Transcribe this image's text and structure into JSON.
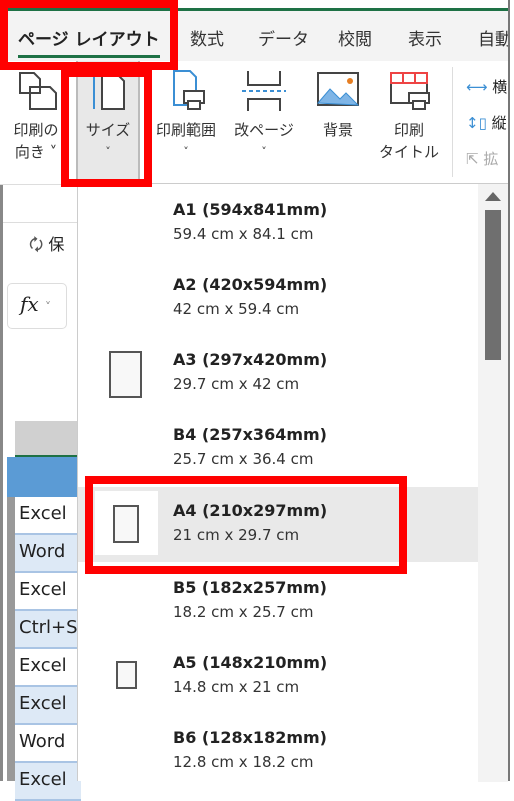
{
  "tabs": [
    {
      "label": "ページ レイアウト",
      "active": true
    },
    {
      "label": "数式"
    },
    {
      "label": "データ"
    },
    {
      "label": "校閲"
    },
    {
      "label": "表示"
    },
    {
      "label": "自動"
    }
  ],
  "ribbon": {
    "orientation": {
      "line1": "印刷の",
      "line2": "向き ˅"
    },
    "size": {
      "label": "サイズ",
      "chevron": "˅"
    },
    "print_area": {
      "label": "印刷範囲",
      "chevron": "˅"
    },
    "breaks": {
      "label": "改ページ",
      "chevron": "˅"
    },
    "background": {
      "label": "背景"
    },
    "print_titles": {
      "line1": "印刷",
      "line2": "タイトル"
    },
    "right": {
      "width": "横",
      "height": "縦",
      "scale": "拡"
    }
  },
  "sheet": {
    "save_label": "保",
    "fx": "fx",
    "rows": [
      "Excel",
      "Word",
      "Excel",
      "Ctrl+S",
      "Excel",
      "Excel",
      "Word",
      "Excel"
    ]
  },
  "size_menu": {
    "selected": "A4",
    "items": [
      {
        "name": "A1 (594x841mm)",
        "dims": "59.4 cm x 84.1 cm"
      },
      {
        "name": "A2 (420x594mm)",
        "dims": "42 cm x 59.4 cm"
      },
      {
        "name": "A3 (297x420mm)",
        "dims": "29.7 cm x 42 cm"
      },
      {
        "name": "B4 (257x364mm)",
        "dims": "25.7 cm x 36.4 cm"
      },
      {
        "name": "A4 (210x297mm)",
        "dims": "21 cm x 29.7 cm"
      },
      {
        "name": "B5 (182x257mm)",
        "dims": "18.2 cm x 25.7 cm"
      },
      {
        "name": "A5 (148x210mm)",
        "dims": "14.8 cm x 21 cm"
      },
      {
        "name": "B6 (128x182mm)",
        "dims": "12.8 cm x 18.2 cm"
      }
    ]
  },
  "colors": {
    "accent": "#1e7145",
    "highlight": "#ff0000",
    "selected_bg": "#e9e9e9"
  }
}
